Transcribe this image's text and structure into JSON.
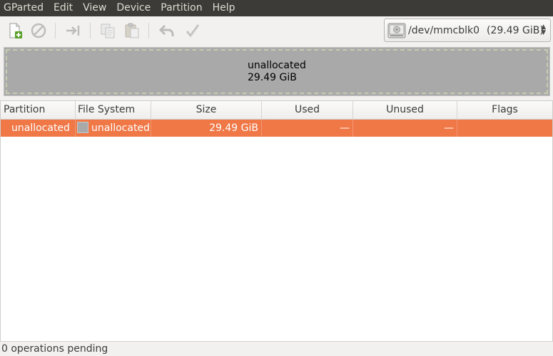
{
  "menubar": {
    "items": [
      "GParted",
      "Edit",
      "View",
      "Device",
      "Partition",
      "Help"
    ]
  },
  "toolbar": {
    "buttons": [
      {
        "name": "new-partition",
        "icon": "new-document-plus-icon"
      },
      {
        "name": "delete-partition",
        "icon": "no-entry-icon"
      },
      {
        "name": "resize-move",
        "icon": "arrow-to-bar-icon"
      },
      {
        "name": "copy",
        "icon": "copy-icon"
      },
      {
        "name": "paste",
        "icon": "paste-icon"
      },
      {
        "name": "undo",
        "icon": "undo-arrow-icon"
      },
      {
        "name": "apply",
        "icon": "checkmark-icon"
      }
    ]
  },
  "device": {
    "path": "/dev/mmcblk0",
    "size": "(29.49 GiB)",
    "icon": "hard-disk-icon"
  },
  "diskmap": {
    "label": "unallocated",
    "size": "29.49 GiB",
    "color": "#a9a9a9"
  },
  "table": {
    "columns": [
      "Partition",
      "File System",
      "Size",
      "Used",
      "Unused",
      "Flags"
    ],
    "rows": [
      {
        "partition": "unallocated",
        "filesystem": "unallocated",
        "size": "29.49 GiB",
        "used": "—",
        "unused": "—",
        "flags": ""
      }
    ],
    "selected_color": "#f07746"
  },
  "status": {
    "text": "0 operations pending"
  }
}
